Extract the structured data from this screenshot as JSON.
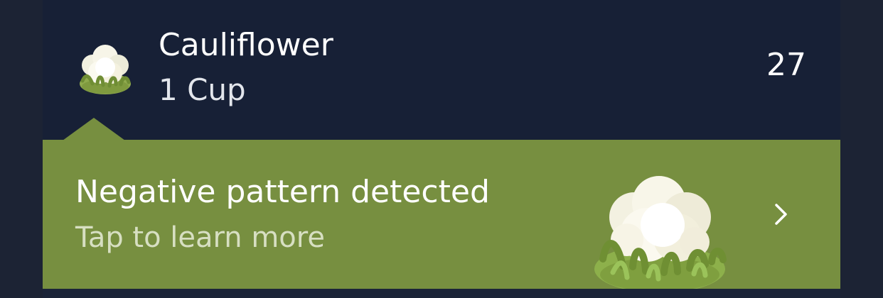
{
  "food": {
    "name": "Cauliflower",
    "serving": "1 Cup",
    "value": "27",
    "icon": "cauliflower-icon"
  },
  "banner": {
    "title": "Negative pattern detected",
    "subtitle": "Tap to learn more",
    "icon": "cauliflower-illustration",
    "chevron_icon": "chevron-right-icon"
  },
  "colors": {
    "background": "#1c2334",
    "row": "#172036",
    "banner": "#778f40",
    "subtitle": "#d7dfc2"
  }
}
